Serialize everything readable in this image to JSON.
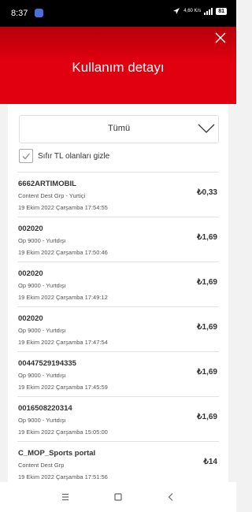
{
  "status_bar": {
    "time": "8:37",
    "net_speed": "4,60 K/s",
    "battery": "81"
  },
  "header": {
    "title": "Kullanım detayı"
  },
  "filter": {
    "selected": "Tümü",
    "hide_zero_label": "Sıfır TL olanları gizle",
    "hide_zero_checked": true
  },
  "transactions": [
    {
      "code": "6662ARTIMOBIL",
      "operator": "Content Dest Grp - Yurtiçi",
      "date": "19 Ekim 2022 Çarşamba 17:54:55",
      "amount": "₺0,33"
    },
    {
      "code": "002020",
      "operator": "Op 9000 - Yurtdışı",
      "date": "19 Ekim 2022 Çarşamba 17:50:46",
      "amount": "₺1,69"
    },
    {
      "code": "002020",
      "operator": "Op 9000 - Yurtdışı",
      "date": "19 Ekim 2022 Çarşamba 17:49:12",
      "amount": "₺1,69"
    },
    {
      "code": "002020",
      "operator": "Op 9000 - Yurtdışı",
      "date": "19 Ekim 2022 Çarşamba 17:47:54",
      "amount": "₺1,69"
    },
    {
      "code": "00447529194335",
      "operator": "Op 9000 - Yurtdışı",
      "date": "19 Ekim 2022 Çarşamba 17:45:59",
      "amount": "₺1,69"
    },
    {
      "code": "0016508220314",
      "operator": "Op 9000 - Yurtdışı",
      "date": "19 Ekim 2022 Çarşamba 15:05:00",
      "amount": "₺1,69"
    },
    {
      "code": "C_MOP_Sports portal",
      "operator": "Content Dest Grp",
      "date": "19 Ekim 2022 Çarşamba 17:51:56",
      "amount": "₺14"
    }
  ],
  "colors": {
    "brand_red": "#e1000f",
    "header_dark": "#b5000b"
  },
  "icons": [
    "close-icon",
    "chevron-down-icon",
    "check-icon",
    "nav-recents-icon",
    "nav-home-icon",
    "nav-back-icon"
  ]
}
